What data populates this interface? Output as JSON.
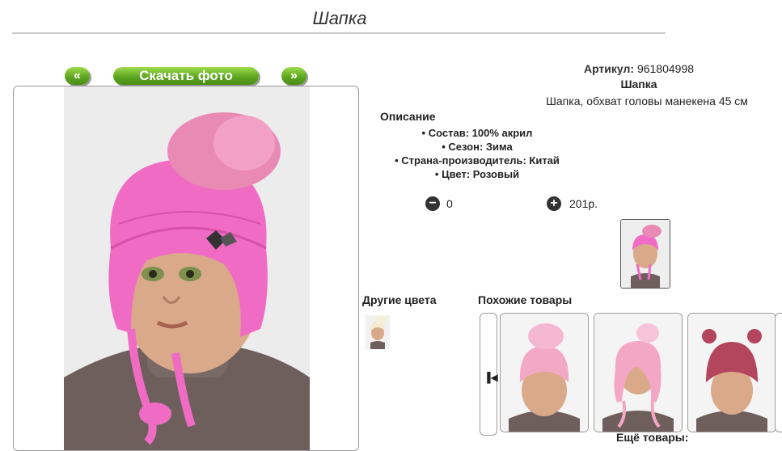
{
  "page": {
    "title": "Шапка"
  },
  "gallery": {
    "prev_label": "«",
    "download_label": "Скачать фото",
    "next_label": "»"
  },
  "product": {
    "article_label": "Артикул:",
    "article_value": "961804998",
    "name": "Шапка",
    "subtitle": "Шапка, обхват головы манекена 45 см"
  },
  "description": {
    "heading": "Описание",
    "items": [
      "Состав: 100% акрил",
      "Сезон: Зима",
      "Страна-производитель: Китай",
      "Цвет: Розовый"
    ]
  },
  "cart": {
    "quantity": "0",
    "price": "201р."
  },
  "icons": {
    "minus": "minus-circle-icon",
    "plus": "plus-circle-icon",
    "carousel_prev": "skip-back-icon"
  },
  "colors": {
    "accent_green": "#5aa21e",
    "hat_pink": "#f06cc4",
    "border": "#9a9a9a"
  },
  "sections": {
    "other_colors": "Другие цвета",
    "similar": "Похожие товары",
    "more": "Ещё товары:"
  }
}
